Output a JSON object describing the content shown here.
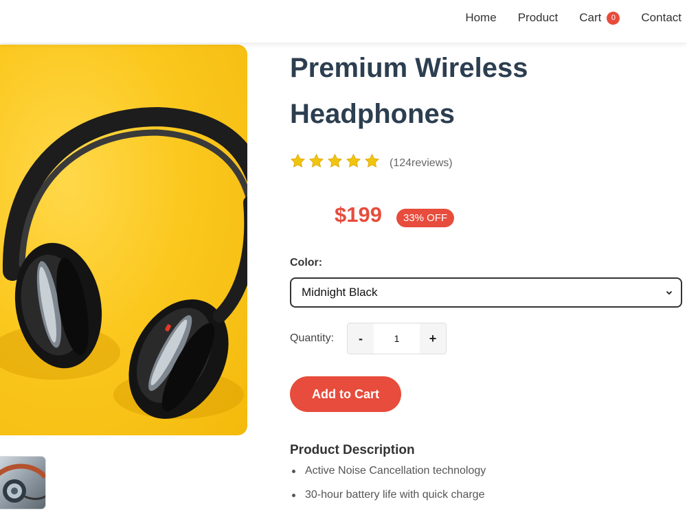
{
  "nav": {
    "items": [
      {
        "label": "Home"
      },
      {
        "label": "Product"
      },
      {
        "label": "Cart",
        "badge": "0"
      },
      {
        "label": "Contact"
      }
    ]
  },
  "gallery": {
    "main_image": "headphones-on-yellow-background",
    "thumbnails": [
      "headphones-closeup-thumbnail"
    ]
  },
  "product": {
    "title": "Premium Wireless Headphones",
    "rating": {
      "stars": 5,
      "max": 5,
      "reviews_text": "(124reviews)"
    },
    "price": "$199",
    "discount": "33% OFF",
    "color": {
      "label": "Color:",
      "selected": "Midnight Black"
    },
    "quantity": {
      "label": "Quantity:",
      "minus": "-",
      "value": "1",
      "plus": "+"
    },
    "add_to_cart": "Add to Cart",
    "description": {
      "heading": "Product Description",
      "features": [
        "Active Noise Cancellation technology",
        "30-hour battery life with quick charge"
      ]
    }
  },
  "colors": {
    "accent": "#e74c3c",
    "title": "#2c3e50",
    "star": "#f1c40f",
    "image_background": "#fbc81f"
  }
}
